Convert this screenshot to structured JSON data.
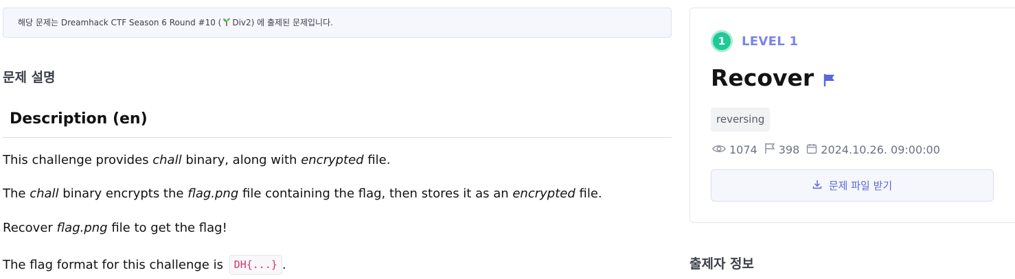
{
  "notice": {
    "prefix": "해당 문제는 Dreamhack CTF Season 6 Round #10 (",
    "sprout_icon": "sprout-icon",
    "suffix": "Div2) 에 출제된 문제입니다."
  },
  "section_title": "문제 설명",
  "description": {
    "heading": "Description (en)",
    "p1": {
      "a": "This challenge provides ",
      "b": "chall",
      "c": " binary, along with ",
      "d": "encrypted",
      "e": " file."
    },
    "p2": {
      "a": "The ",
      "b": "chall",
      "c": " binary encrypts the ",
      "d": "flag.png",
      "e": " file containing the flag, then stores it as an ",
      "f": "encrypted",
      "g": " file."
    },
    "p3": {
      "a": "Recover ",
      "b": "flag.png",
      "c": " file to get the flag!"
    },
    "p4": {
      "a": "The flag format for this challenge is ",
      "code": "DH{...}",
      "b": "."
    }
  },
  "challenge": {
    "level_number": "1",
    "level_label": "LEVEL 1",
    "title": "Recover",
    "tag": "reversing",
    "views": "1074",
    "solves": "398",
    "date": "2024.10.26. 09:00:00",
    "download_label": "문제 파일 받기"
  },
  "author_section_title": "출제자 정보",
  "colors": {
    "accent": "#5a67d8",
    "level_green": "#20c997",
    "level_text": "#7a85e6",
    "code_pink": "#d6336c"
  },
  "icons": {
    "flag": "flag-icon",
    "views": "eye-icon",
    "solves": "flag-outline-icon",
    "date": "calendar-icon",
    "download": "download-icon"
  }
}
